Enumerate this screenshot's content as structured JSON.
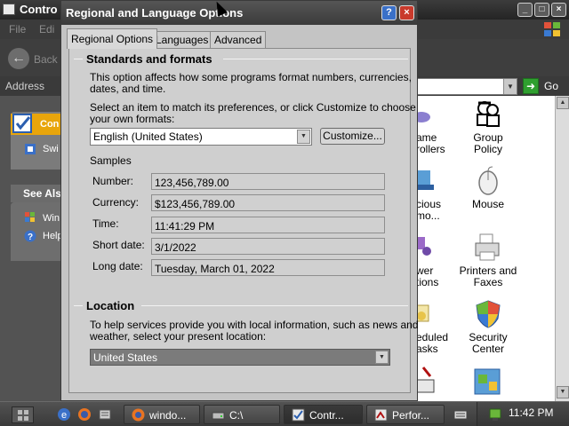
{
  "control_panel": {
    "title": "Contro",
    "menu": [
      "File",
      "Edi"
    ],
    "back_label": "Back",
    "address_label": "Address",
    "go_label": "Go",
    "left_pane": {
      "task_label": "Con",
      "switch_label": "Swi",
      "see_also": "See Als",
      "links": [
        "Win",
        "Help"
      ]
    },
    "items": [
      {
        "label": "Group\nPolicy",
        "icon": "group-policy-icon"
      },
      {
        "label": "Mouse",
        "icon": "mouse-icon"
      },
      {
        "label": "Printers and\nFaxes",
        "icon": "printers-icon"
      },
      {
        "label": "Security\nCenter",
        "icon": "security-center-icon"
      }
    ],
    "cut_items": [
      {
        "label": "ame\nrollers",
        "icon": "game-controllers-icon"
      },
      {
        "label": "cious\nmo...",
        "icon": "malicious-removal-icon"
      },
      {
        "label": "wer\ntions",
        "icon": "power-options-icon"
      },
      {
        "label": "eduled\nasks",
        "icon": "scheduled-tasks-icon"
      }
    ]
  },
  "dialog": {
    "title": "Regional and Language Options",
    "tabs": [
      "Regional Options",
      "Languages",
      "Advanced"
    ],
    "standards": {
      "heading": "Standards and formats",
      "desc1": "This option affects how some programs format numbers, currencies,",
      "desc2": "dates, and time.",
      "select1": "Select an item to match its preferences, or click Customize to choose",
      "select2": "your own formats:",
      "format_value": "English (United States)",
      "customize_label": "Customize...",
      "samples_label": "Samples",
      "samples": [
        {
          "label": "Number:",
          "value": "123,456,789.00"
        },
        {
          "label": "Currency:",
          "value": "$123,456,789.00"
        },
        {
          "label": "Time:",
          "value": "11:41:29 PM"
        },
        {
          "label": "Short date:",
          "value": "3/1/2022"
        },
        {
          "label": "Long date:",
          "value": "Tuesday, March 01, 2022"
        }
      ]
    },
    "location": {
      "heading": "Location",
      "desc1": "To help services provide you with local information, such as news and",
      "desc2": "weather, select your present location:",
      "value": "United States"
    }
  },
  "taskbar": {
    "buttons": [
      {
        "label": "windo...",
        "icon": "firefox-icon"
      },
      {
        "label": "C:\\",
        "icon": "drive-icon"
      },
      {
        "label": "Contr...",
        "icon": "control-panel-icon"
      },
      {
        "label": "Perfor...",
        "icon": "performance-icon"
      }
    ],
    "clock": "11:42 PM"
  },
  "colors": {
    "accent": "#3a70c8",
    "close": "#c93a2c",
    "go": "#2f9f2f"
  }
}
